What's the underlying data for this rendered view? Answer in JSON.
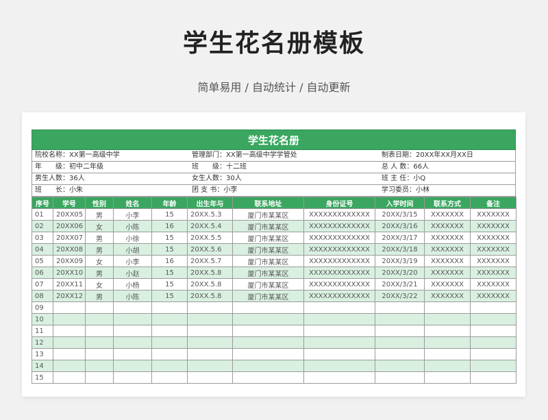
{
  "page": {
    "title": "学生花名册模板",
    "subtitle": "简单易用 / 自动统计 / 自动更新"
  },
  "sheet": {
    "title": "学生花名册",
    "info": [
      [
        "院校名称：XX第一高级中学",
        "管理部门：XX第一高级中学学管处",
        "制表日期：20XX年XX月XX日"
      ],
      [
        "年　　级：初中二年级",
        "班　　级：十二班",
        "总 人 数：66人"
      ],
      [
        "男生人数：36人",
        "女生人数：30人",
        "班 主 任：小Q"
      ],
      [
        "班　　长：小朱",
        "团 支 书：小李",
        "学习委员：小林"
      ]
    ],
    "columns": [
      "序号",
      "学号",
      "性别",
      "姓名",
      "年龄",
      "出生年与",
      "联系地址",
      "身份证号",
      "入学时间",
      "联系方式",
      "备注"
    ],
    "rows": [
      [
        "01",
        "20XX05",
        "男",
        "小李",
        "15",
        "20XX.5.3",
        "厦门市某某区",
        "XXXXXXXXXXXXX",
        "20XX/3/15",
        "XXXXXXX",
        "XXXXXXX"
      ],
      [
        "02",
        "20XX06",
        "女",
        "小陈",
        "16",
        "20XX.5.4",
        "厦门市某某区",
        "XXXXXXXXXXXXX",
        "20XX/3/16",
        "XXXXXXX",
        "XXXXXXX"
      ],
      [
        "03",
        "20XX07",
        "男",
        "小徐",
        "15",
        "20XX.5.5",
        "厦门市某某区",
        "XXXXXXXXXXXXX",
        "20XX/3/17",
        "XXXXXXX",
        "XXXXXXX"
      ],
      [
        "04",
        "20XX08",
        "男",
        "小胡",
        "15",
        "20XX.5.6",
        "厦门市某某区",
        "XXXXXXXXXXXXX",
        "20XX/3/18",
        "XXXXXXX",
        "XXXXXXX"
      ],
      [
        "05",
        "20XX09",
        "女",
        "小李",
        "16",
        "20XX.5.7",
        "厦门市某某区",
        "XXXXXXXXXXXXX",
        "20XX/3/19",
        "XXXXXXX",
        "XXXXXXX"
      ],
      [
        "06",
        "20XX10",
        "男",
        "小赵",
        "15",
        "20XX.5.8",
        "厦门市某某区",
        "XXXXXXXXXXXXX",
        "20XX/3/20",
        "XXXXXXX",
        "XXXXXXX"
      ],
      [
        "07",
        "20XX11",
        "女",
        "小杨",
        "15",
        "20XX.5.8",
        "厦门市某某区",
        "XXXXXXXXXXXXX",
        "20XX/3/21",
        "XXXXXXX",
        "XXXXXXX"
      ],
      [
        "08",
        "20XX12",
        "男",
        "小陈",
        "15",
        "20XX.5.8",
        "厦门市某某区",
        "XXXXXXXXXXXXX",
        "20XX/3/22",
        "XXXXXXX",
        "XXXXXXX"
      ],
      [
        "09",
        "",
        "",
        "",
        "",
        "",
        "",
        "",
        "",
        "",
        ""
      ],
      [
        "10",
        "",
        "",
        "",
        "",
        "",
        "",
        "",
        "",
        "",
        ""
      ],
      [
        "11",
        "",
        "",
        "",
        "",
        "",
        "",
        "",
        "",
        "",
        ""
      ],
      [
        "12",
        "",
        "",
        "",
        "",
        "",
        "",
        "",
        "",
        "",
        ""
      ],
      [
        "13",
        "",
        "",
        "",
        "",
        "",
        "",
        "",
        "",
        "",
        ""
      ],
      [
        "14",
        "",
        "",
        "",
        "",
        "",
        "",
        "",
        "",
        "",
        ""
      ],
      [
        "15",
        "",
        "",
        "",
        "",
        "",
        "",
        "",
        "",
        "",
        ""
      ]
    ]
  },
  "colors": {
    "header_green": "#3aa660",
    "alt_row_green": "#d9f0e1"
  }
}
